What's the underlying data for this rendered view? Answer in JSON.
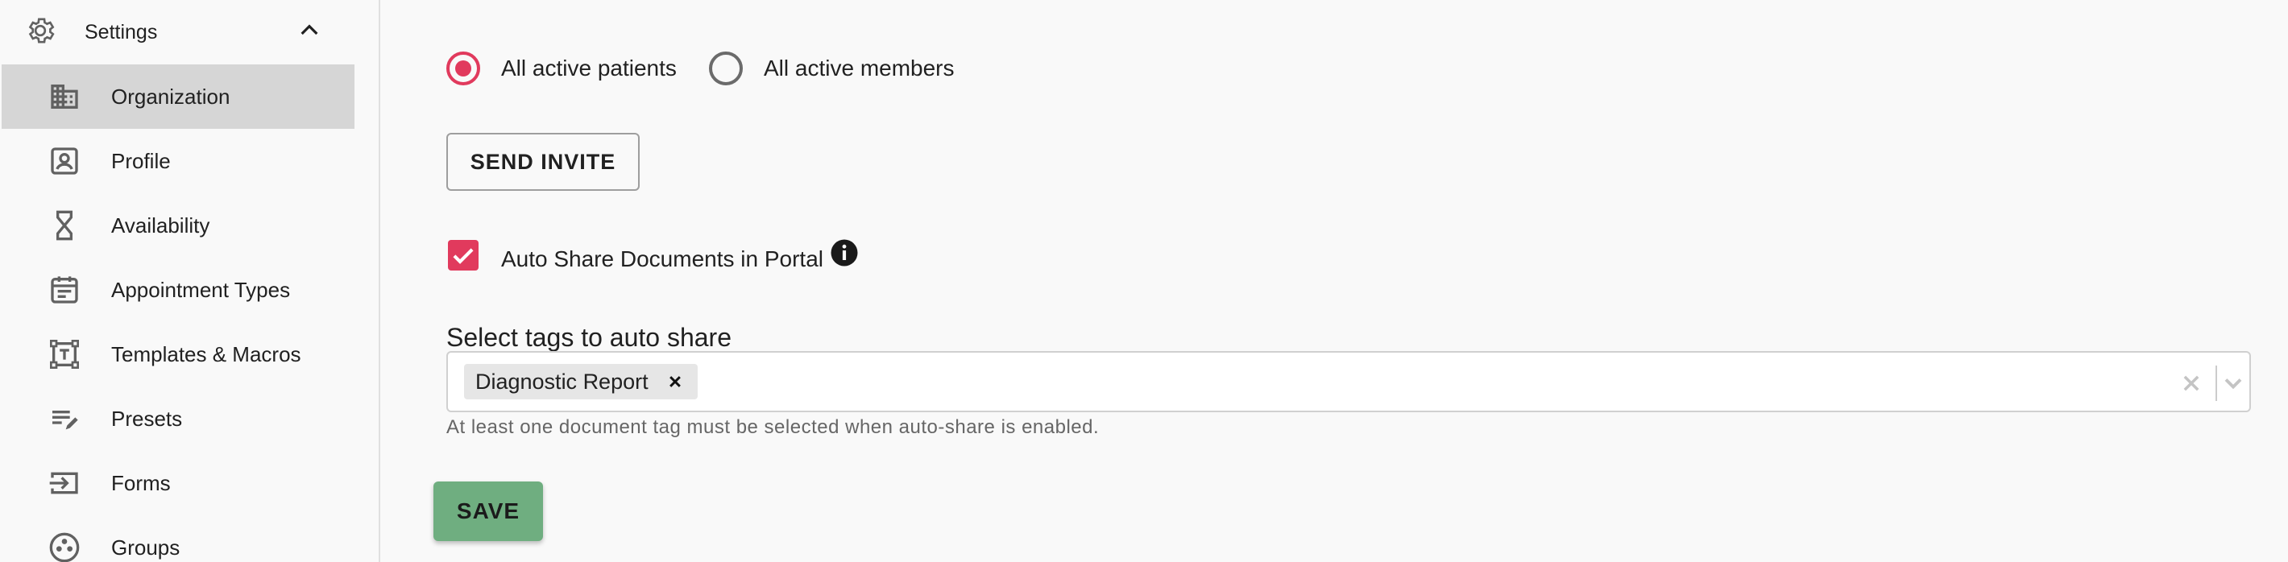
{
  "sidebar": {
    "header": {
      "label": "Settings",
      "icon": "gear-icon",
      "toggle_icon": "chevron-up-icon"
    },
    "items": [
      {
        "label": "Organization",
        "icon": "building-icon",
        "active": true
      },
      {
        "label": "Profile",
        "icon": "profile-card-icon"
      },
      {
        "label": "Availability",
        "icon": "hourglass-icon"
      },
      {
        "label": "Appointment Types",
        "icon": "calendar-icon"
      },
      {
        "label": "Templates & Macros",
        "icon": "text-template-icon"
      },
      {
        "label": "Presets",
        "icon": "edit-list-icon"
      },
      {
        "label": "Forms",
        "icon": "input-arrow-icon"
      },
      {
        "label": "Groups",
        "icon": "group-icon"
      }
    ]
  },
  "invite": {
    "options": [
      {
        "label": "All active patients",
        "selected": true
      },
      {
        "label": "All active members",
        "selected": false
      }
    ],
    "send_label": "SEND INVITE"
  },
  "auto_share": {
    "label": "Auto Share Documents in Portal",
    "checked": true,
    "info_icon": "info-icon"
  },
  "tags": {
    "title": "Select tags to auto share",
    "selected": [
      "Diagnostic Report"
    ],
    "helper": "At least one document tag must be selected when auto-share is enabled."
  },
  "save_label": "SAVE",
  "colors": {
    "accent": "#e13a5d",
    "save": "#6fae80",
    "active_item": "#d6d6d6"
  }
}
